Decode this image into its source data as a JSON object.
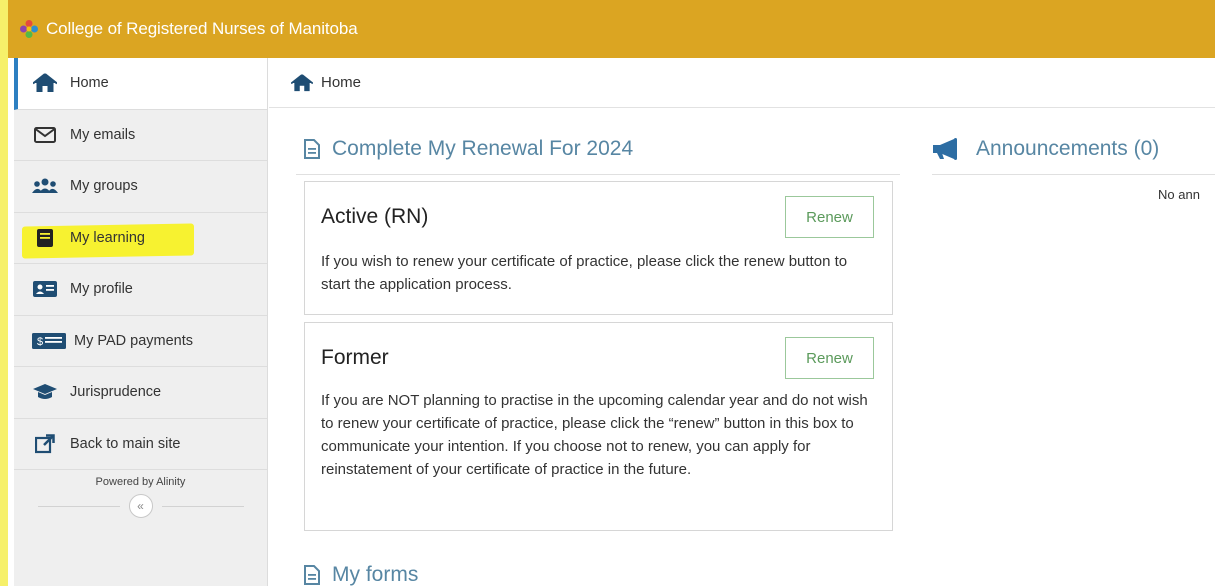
{
  "header": {
    "title": "College of Registered Nurses of Manitoba",
    "logo_icon": "crnm-logo"
  },
  "sidebar": {
    "items": [
      {
        "label": "Home",
        "icon": "home-icon",
        "active": true
      },
      {
        "label": "My emails",
        "icon": "envelope-icon"
      },
      {
        "label": "My groups",
        "icon": "users-icon"
      },
      {
        "label": "My learning",
        "icon": "book-icon",
        "highlighted": true
      },
      {
        "label": "My profile",
        "icon": "id-card-icon"
      },
      {
        "label": "My PAD payments",
        "icon": "money-bill-icon"
      },
      {
        "label": "Jurisprudence",
        "icon": "graduation-cap-icon"
      },
      {
        "label": "Back to main site",
        "icon": "external-link-icon"
      }
    ],
    "powered_by": "Powered by Alinity",
    "collapse_label": "«"
  },
  "breadcrumb": {
    "label": "Home"
  },
  "renewal": {
    "title": "Complete My Renewal For 2024",
    "cards": [
      {
        "title": "Active (RN)",
        "button": "Renew",
        "text": "If you wish to renew your certificate of practice, please click the renew button to start the application process."
      },
      {
        "title": "Former",
        "button": "Renew",
        "text": "If you are NOT planning to practise in the upcoming calendar year and do not wish to renew your certificate of practice, please click the “renew” button in this box to communicate your intention. If you choose not to renew, you can apply for reinstatement of your certificate of practice in the future."
      }
    ]
  },
  "announcements": {
    "title": "Announcements (0)",
    "empty_text": "No ann"
  },
  "forms": {
    "title": "My forms"
  },
  "colors": {
    "header": "#dba522",
    "accent": "#5786a3",
    "button_green": "#5b9a5b",
    "highlighter": "#f7f230"
  }
}
